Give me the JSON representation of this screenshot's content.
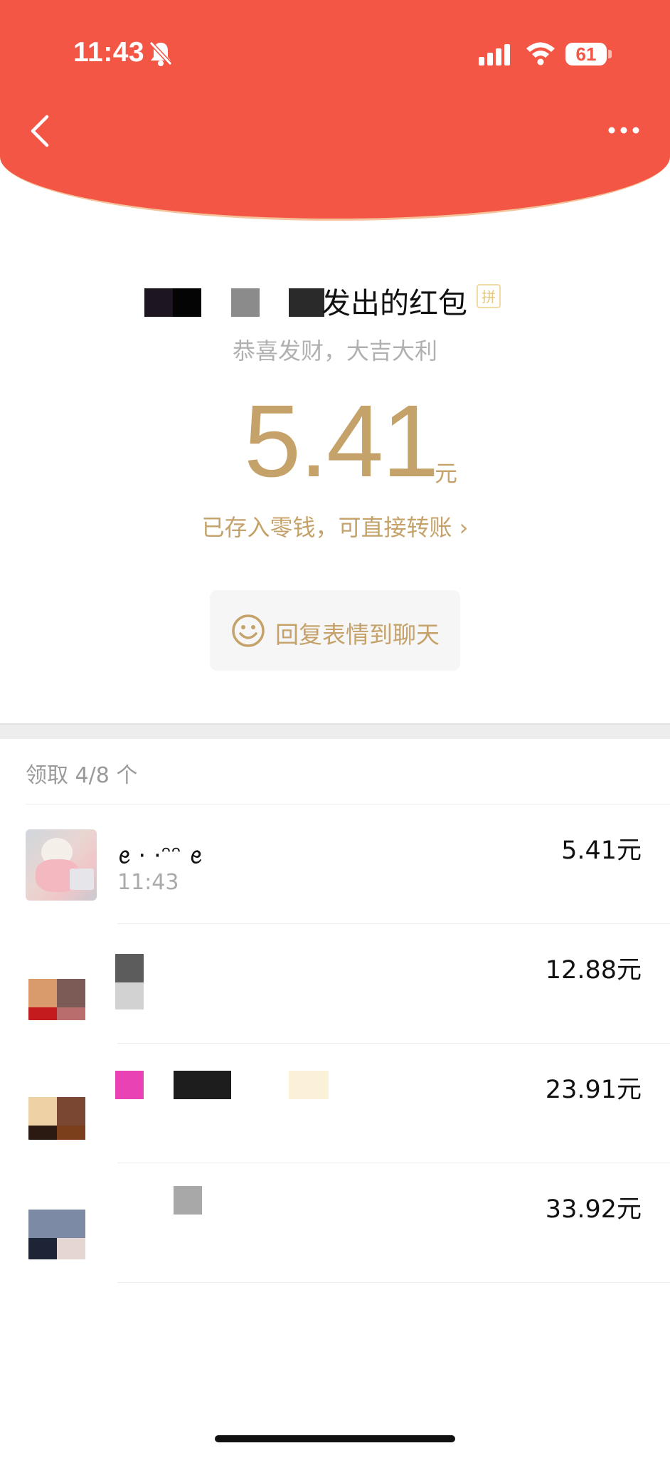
{
  "status_bar": {
    "time": "11:43",
    "battery": "61"
  },
  "icons": {
    "back": "chevron-left-icon",
    "more": "more-dots-icon",
    "smile": "smile-icon",
    "bell": "bell-slash-icon",
    "signal": "cellular-signal-icon",
    "wifi": "wifi-icon"
  },
  "envelope": {
    "sender_suffix": "发出的红包",
    "pin_badge": "拼",
    "greeting": "恭喜发财，大吉大利",
    "amount": "5.41",
    "unit": "元",
    "saved_link": "已存入零钱，可直接转账 ›",
    "reply_button": "回复表情到聊天"
  },
  "receivers": {
    "count_label": "领取 4/8 个",
    "items": [
      {
        "name": "ꫀ · ·ᵔᵔ ꫀ",
        "time": "11:43",
        "amount": "5.41元"
      },
      {
        "name": "",
        "time": "",
        "amount": "12.88元"
      },
      {
        "name": "",
        "time": "",
        "amount": "23.91元"
      },
      {
        "name": "",
        "time": "",
        "amount": "33.92元"
      }
    ]
  },
  "colors": {
    "header_red": "#f45645",
    "gold": "#c4a269"
  }
}
